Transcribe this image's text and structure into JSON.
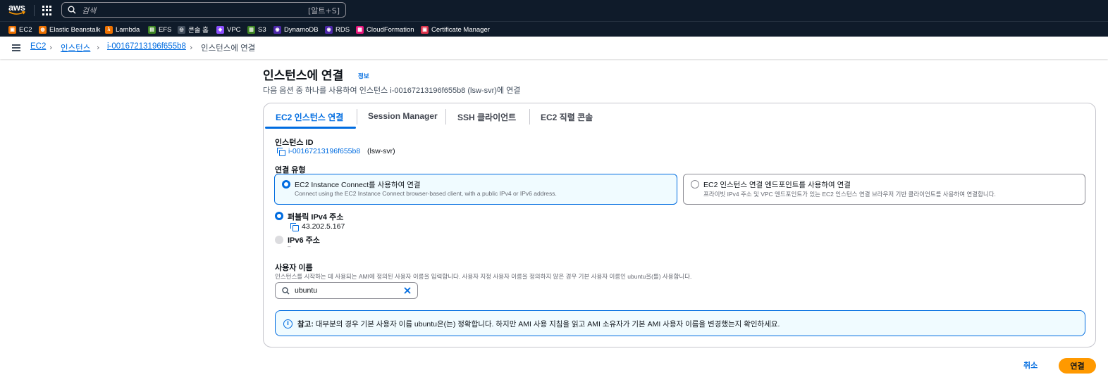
{
  "topnav": {
    "logo": "aws",
    "search_placeholder": "검색",
    "search_shortcut": "[알트+S]"
  },
  "favorites": [
    {
      "label": "EC2",
      "color": "#ed7100"
    },
    {
      "label": "Elastic Beanstalk",
      "color": "#ed7100"
    },
    {
      "label": "Lambda",
      "color": "#ed7100"
    },
    {
      "label": "EFS",
      "color": "#3f8624"
    },
    {
      "label": "콘솔 홈",
      "color": "#414d5c"
    },
    {
      "label": "VPC",
      "color": "#8c4fff"
    },
    {
      "label": "S3",
      "color": "#3f8624"
    },
    {
      "label": "DynamoDB",
      "color": "#4d27aa"
    },
    {
      "label": "RDS",
      "color": "#4d27aa"
    },
    {
      "label": "CloudFormation",
      "color": "#e7157b"
    },
    {
      "label": "Certificate Manager",
      "color": "#dd344c"
    }
  ],
  "breadcrumb": {
    "ec2": "EC2",
    "instances": "인스턴스",
    "instance_id": "i-00167213196f655b8",
    "current": "인스턴스에 연결"
  },
  "header": {
    "title": "인스턴스에 연결",
    "info": "정보",
    "description": "다음 옵션 중 하나를 사용하여 인스턴스 i-00167213196f655b8 (lsw-svr)에 연결"
  },
  "tabs": [
    "EC2 인스턴스 연결",
    "Session Manager",
    "SSH 클라이언트",
    "EC2 직렬 콘솔"
  ],
  "instance": {
    "label": "인스턴스 ID",
    "id": "i-00167213196f655b8",
    "name": "(lsw-svr)"
  },
  "connection_type": {
    "label": "연결 유형",
    "option1_title": "EC2 Instance Connect를 사용하여 연결",
    "option1_desc": "Connect using the EC2 Instance Connect browser-based client, with a public IPv4 or IPv6 address.",
    "option2_title": "EC2 인스턴스 연결 엔드포인트를 사용하여 연결",
    "option2_desc": "프라이빗 IPv4 주소 및 VPC 엔드포인트가 있는 EC2 인스턴스 연결 브라우저 기반 클라이언트를 사용하여 연결합니다."
  },
  "address": {
    "ipv4_label": "퍼블릭 IPv4 주소",
    "ipv4_value": "43.202.5.167",
    "ipv6_label": "IPv6 주소",
    "ipv6_value": "–"
  },
  "username": {
    "label": "사용자 이름",
    "help": "인스턴스를 시작하는 데 사용되는 AMI에 정의된 사용자 이름을 입력합니다. 사용자 지정 사용자 이름을 정의하지 않은 경우 기본 사용자 이름인 ubuntu을(를) 사용합니다.",
    "value": "ubuntu"
  },
  "alert": {
    "prefix": "참고:",
    "text": " 대부분의 경우 기본 사용자 이름 ubuntu은(는) 정확합니다. 하지만 AMI 사용 지침을 읽고 AMI 소유자가 기본 AMI 사용자 이름을 변경했는지 확인하세요."
  },
  "actions": {
    "cancel": "취소",
    "connect": "연결"
  }
}
